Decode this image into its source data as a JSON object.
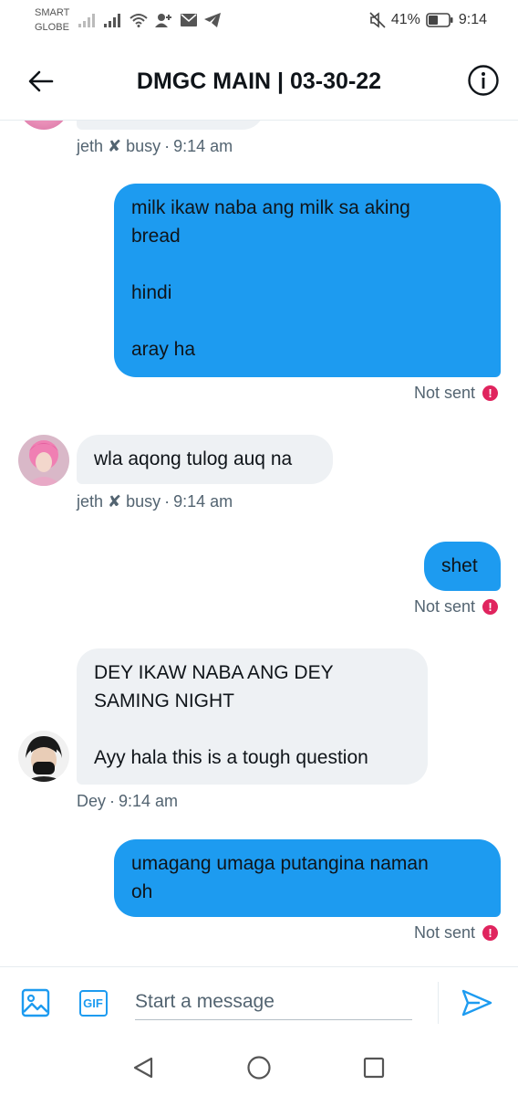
{
  "status_bar": {
    "carrier_line1": "SMART",
    "carrier_line2": "GLOBE",
    "battery": "41%",
    "time": "9:14"
  },
  "header": {
    "title": "DMGC MAIN | 03-30-22",
    "back_icon": "arrow-left-icon",
    "info_icon": "info-circle-icon"
  },
  "messages": [
    {
      "direction": "in",
      "sender": "jeth ✘ busy",
      "time": "9:14 am"
    },
    {
      "direction": "out",
      "text": "milk ikaw naba ang milk sa aking\nbread\n\nhindi\n\naray ha",
      "status": "Not sent"
    },
    {
      "direction": "in",
      "text": "wla aqong tulog auq na",
      "sender": "jeth ✘ busy",
      "time": "9:14 am"
    },
    {
      "direction": "out",
      "text": "shet",
      "status": "Not sent"
    },
    {
      "direction": "in",
      "text": "DEY IKAW NABA ANG DEY\nSAMING NIGHT\n\nAyy hala this is a tough question",
      "sender": "Dey",
      "time": "9:14 am"
    },
    {
      "direction": "out",
      "text": "umagang umaga putangina naman\noh",
      "status": "Not sent"
    }
  ],
  "meta_separator": "·",
  "error_glyph": "!",
  "composer": {
    "placeholder": "Start a message",
    "gif_label": "GIF"
  },
  "colors": {
    "accent": "#1d9bf0",
    "incoming_bubble": "#eef1f4",
    "error": "#e0245e",
    "meta_text": "#536471"
  }
}
